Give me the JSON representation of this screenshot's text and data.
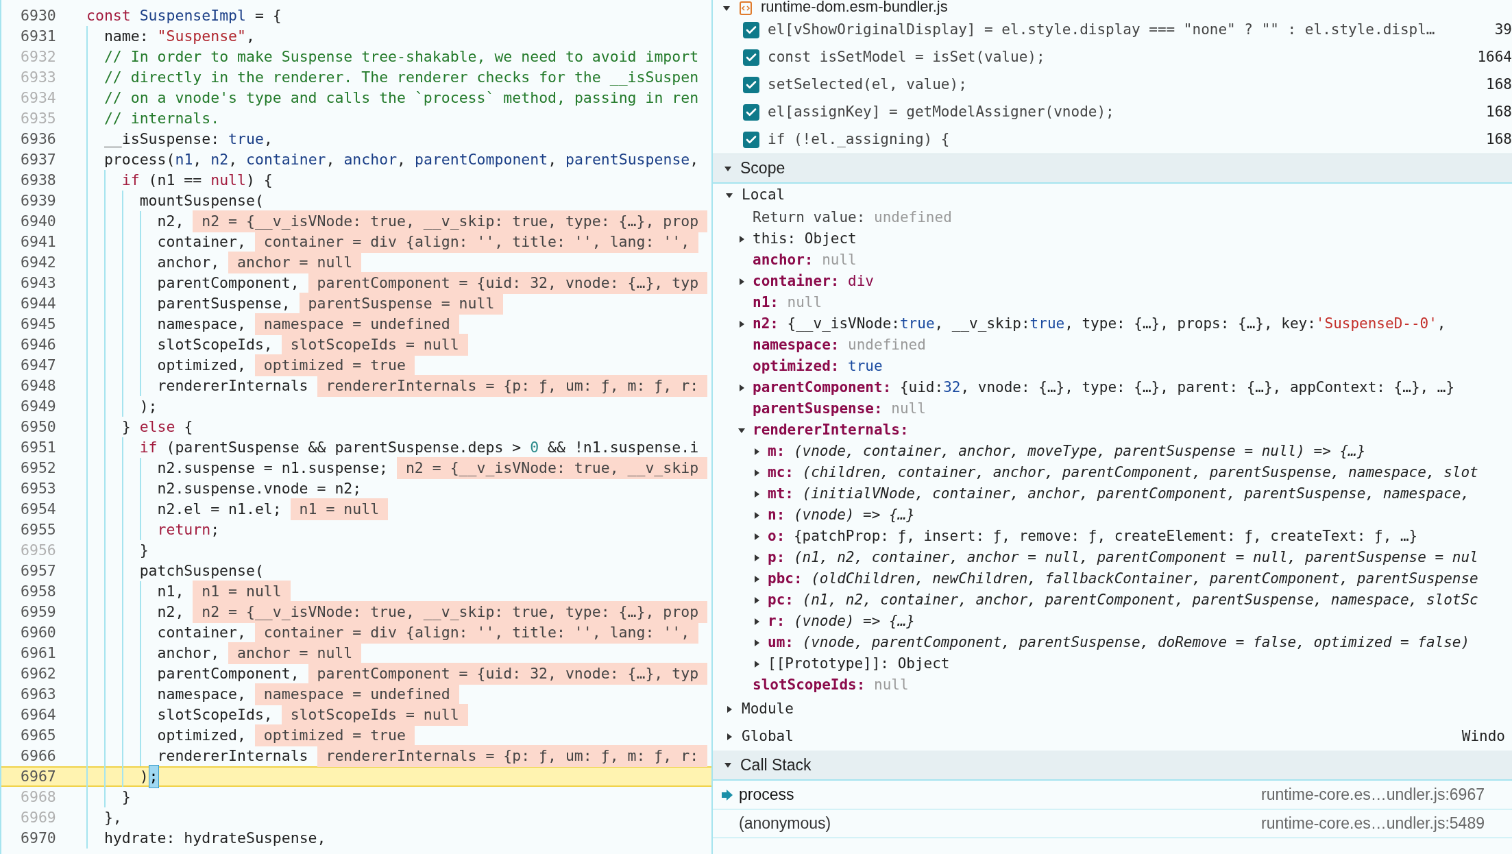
{
  "editor": {
    "lines": [
      {
        "number": "6930",
        "breakable": true,
        "code": [
          {
            "kind": "keyword",
            "text": "const"
          },
          {
            "kind": "name",
            "text": " SuspenseImpl"
          },
          {
            "kind": "plain",
            "text": " = {"
          }
        ],
        "children": [
          {
            "number": "6931",
            "breakable": true,
            "code": [
              {
                "kind": "plain",
                "text": "name:"
              },
              {
                "kind": "string",
                "text": " \"Suspense\""
              },
              {
                "kind": "plain",
                "text": ","
              }
            ]
          },
          {
            "number": "6932",
            "breakable": false,
            "code": [
              {
                "kind": "comment",
                "text": "// In order to make Suspense tree-shakable, we need to avoid import"
              }
            ]
          },
          {
            "number": "6933",
            "breakable": false,
            "code": [
              {
                "kind": "comment",
                "text": "// directly in the renderer. The renderer checks for the __isSuspen"
              }
            ]
          },
          {
            "number": "6934",
            "breakable": false,
            "code": [
              {
                "kind": "comment",
                "text": "// on a vnode's type and calls the `process` method, passing in ren"
              }
            ]
          },
          {
            "number": "6935",
            "breakable": false,
            "code": [
              {
                "kind": "comment",
                "text": "// internals."
              }
            ]
          },
          {
            "number": "6936",
            "breakable": true,
            "code": [
              {
                "kind": "plain",
                "text": "__isSuspense:"
              },
              {
                "kind": "literal",
                "text": " true"
              },
              {
                "kind": "plain",
                "text": ","
              }
            ]
          },
          {
            "number": "6937",
            "breakable": true,
            "code": [
              {
                "kind": "plain",
                "text": "process("
              },
              {
                "kind": "name",
                "text": "n1"
              },
              {
                "kind": "plain",
                "text": ","
              },
              {
                "kind": "name",
                "text": " n2"
              },
              {
                "kind": "plain",
                "text": ","
              },
              {
                "kind": "name",
                "text": " container"
              },
              {
                "kind": "plain",
                "text": ","
              },
              {
                "kind": "name",
                "text": " anchor"
              },
              {
                "kind": "plain",
                "text": ","
              },
              {
                "kind": "name",
                "text": " parentComponent"
              },
              {
                "kind": "plain",
                "text": ","
              },
              {
                "kind": "name",
                "text": " parentSuspense"
              },
              {
                "kind": "plain",
                "text": ","
              }
            ],
            "children": [
              {
                "number": "6938",
                "breakable": true,
                "code": [
                  {
                    "kind": "keyword",
                    "text": "if"
                  },
                  {
                    "kind": "plain",
                    "text": " (n1 =="
                  },
                  {
                    "kind": "keyword",
                    "text": " null"
                  },
                  {
                    "kind": "plain",
                    "text": ") {"
                  }
                ],
                "children": [
                  {
                    "number": "6939",
                    "breakable": true,
                    "code": [
                      {
                        "kind": "plain",
                        "text": "mountSuspense("
                      }
                    ],
                    "children": [
                      {
                        "number": "6940",
                        "breakable": true,
                        "code": [
                          {
                            "kind": "plain",
                            "text": "n2,"
                          }
                        ],
                        "value": "n2 = {__v_isVNode: true, __v_skip: true, type: {…}, prop"
                      },
                      {
                        "number": "6941",
                        "breakable": true,
                        "code": [
                          {
                            "kind": "plain",
                            "text": "container,"
                          }
                        ],
                        "value": "container = div {align: '', title: '', lang: '',"
                      },
                      {
                        "number": "6942",
                        "breakable": true,
                        "code": [
                          {
                            "kind": "plain",
                            "text": "anchor,"
                          }
                        ],
                        "value": "anchor = null"
                      },
                      {
                        "number": "6943",
                        "breakable": true,
                        "code": [
                          {
                            "kind": "plain",
                            "text": "parentComponent,"
                          }
                        ],
                        "value": "parentComponent = {uid: 32, vnode: {…}, typ"
                      },
                      {
                        "number": "6944",
                        "breakable": true,
                        "code": [
                          {
                            "kind": "plain",
                            "text": "parentSuspense,"
                          }
                        ],
                        "value": "parentSuspense = null"
                      },
                      {
                        "number": "6945",
                        "breakable": true,
                        "code": [
                          {
                            "kind": "plain",
                            "text": "namespace,"
                          }
                        ],
                        "value": "namespace = undefined"
                      },
                      {
                        "number": "6946",
                        "breakable": true,
                        "code": [
                          {
                            "kind": "plain",
                            "text": "slotScopeIds,"
                          }
                        ],
                        "value": "slotScopeIds = null"
                      },
                      {
                        "number": "6947",
                        "breakable": true,
                        "code": [
                          {
                            "kind": "plain",
                            "text": "optimized,"
                          }
                        ],
                        "value": "optimized = true"
                      },
                      {
                        "number": "6948",
                        "breakable": true,
                        "code": [
                          {
                            "kind": "plain",
                            "text": "rendererInternals"
                          }
                        ],
                        "value": "rendererInternals = {p: ƒ, um: ƒ, m: ƒ, r:"
                      }
                    ]
                  },
                  {
                    "number": "6949",
                    "breakable": true,
                    "code": [
                      {
                        "kind": "plain",
                        "text": ");"
                      }
                    ]
                  }
                ]
              },
              {
                "number": "6950",
                "breakable": true,
                "code": [
                  {
                    "kind": "plain",
                    "text": "}"
                  },
                  {
                    "kind": "keyword",
                    "text": " else"
                  },
                  {
                    "kind": "plain",
                    "text": " {"
                  }
                ],
                "children": [
                  {
                    "number": "6951",
                    "breakable": true,
                    "code": [
                      {
                        "kind": "keyword",
                        "text": "if"
                      },
                      {
                        "kind": "plain",
                        "text": " (parentSuspense && parentSuspense.deps >"
                      },
                      {
                        "kind": "number",
                        "text": " 0"
                      },
                      {
                        "kind": "plain",
                        "text": " && !n1.suspense.i"
                      }
                    ],
                    "children": [
                      {
                        "number": "6952",
                        "breakable": true,
                        "code": [
                          {
                            "kind": "plain",
                            "text": "n2.suspense = n1.suspense;"
                          }
                        ],
                        "value": "n2 = {__v_isVNode: true, __v_skip"
                      },
                      {
                        "number": "6953",
                        "breakable": true,
                        "code": [
                          {
                            "kind": "plain",
                            "text": "n2.suspense.vnode = n2;"
                          }
                        ]
                      },
                      {
                        "number": "6954",
                        "breakable": true,
                        "code": [
                          {
                            "kind": "plain",
                            "text": "n2.el = n1.el;"
                          }
                        ],
                        "value": "n1 = null"
                      },
                      {
                        "number": "6955",
                        "breakable": true,
                        "code": [
                          {
                            "kind": "keyword",
                            "text": "return"
                          },
                          {
                            "kind": "plain",
                            "text": ";"
                          }
                        ]
                      }
                    ]
                  },
                  {
                    "number": "6956",
                    "breakable": false,
                    "code": [
                      {
                        "kind": "plain",
                        "text": "}"
                      }
                    ]
                  },
                  {
                    "number": "6957",
                    "breakable": true,
                    "code": [
                      {
                        "kind": "plain",
                        "text": "patchSuspense("
                      }
                    ],
                    "children": [
                      {
                        "number": "6958",
                        "breakable": true,
                        "code": [
                          {
                            "kind": "plain",
                            "text": "n1,"
                          }
                        ],
                        "value": "n1 = null"
                      },
                      {
                        "number": "6959",
                        "breakable": true,
                        "code": [
                          {
                            "kind": "plain",
                            "text": "n2,"
                          }
                        ],
                        "value": "n2 = {__v_isVNode: true, __v_skip: true, type: {…}, prop"
                      },
                      {
                        "number": "6960",
                        "breakable": true,
                        "code": [
                          {
                            "kind": "plain",
                            "text": "container,"
                          }
                        ],
                        "value": "container = div {align: '', title: '', lang: '',"
                      },
                      {
                        "number": "6961",
                        "breakable": true,
                        "code": [
                          {
                            "kind": "plain",
                            "text": "anchor,"
                          }
                        ],
                        "value": "anchor = null"
                      },
                      {
                        "number": "6962",
                        "breakable": true,
                        "code": [
                          {
                            "kind": "plain",
                            "text": "parentComponent,"
                          }
                        ],
                        "value": "parentComponent = {uid: 32, vnode: {…}, typ"
                      },
                      {
                        "number": "6963",
                        "breakable": true,
                        "code": [
                          {
                            "kind": "plain",
                            "text": "namespace,"
                          }
                        ],
                        "value": "namespace = undefined"
                      },
                      {
                        "number": "6964",
                        "breakable": true,
                        "code": [
                          {
                            "kind": "plain",
                            "text": "slotScopeIds,"
                          }
                        ],
                        "value": "slotScopeIds = null"
                      },
                      {
                        "number": "6965",
                        "breakable": true,
                        "code": [
                          {
                            "kind": "plain",
                            "text": "optimized,"
                          }
                        ],
                        "value": "optimized = true"
                      },
                      {
                        "number": "6966",
                        "breakable": true,
                        "code": [
                          {
                            "kind": "plain",
                            "text": "rendererInternals"
                          }
                        ],
                        "value": "rendererInternals = {p: ƒ, um: ƒ, m: ƒ, r:"
                      }
                    ]
                  },
                  {
                    "number": "6967",
                    "breakable": true,
                    "current": true,
                    "code": [
                      {
                        "kind": "plain",
                        "text": ")"
                      }
                    ],
                    "pause": ";"
                  }
                ]
              },
              {
                "number": "6968",
                "breakable": false,
                "code": [
                  {
                    "kind": "plain",
                    "text": "}"
                  }
                ]
              }
            ]
          },
          {
            "number": "6969",
            "breakable": false,
            "code": [
              {
                "kind": "plain",
                "text": "},"
              }
            ]
          },
          {
            "number": "6970",
            "breakable": true,
            "code": [
              {
                "kind": "plain",
                "text": "hydrate: hydrateSuspense,"
              }
            ]
          }
        ]
      }
    ]
  },
  "breakpoints": {
    "file": "runtime-dom.esm-bundler.js",
    "expanded": true,
    "items": [
      {
        "code": "el[vShowOriginalDisplay] = el.style.display === \"none\" ? \"\" : el.style.displ…",
        "line": "39",
        "checked": true
      },
      {
        "code": "const isSetModel = isSet(value);",
        "line": "1664",
        "checked": true
      },
      {
        "code": "setSelected(el, value);",
        "line": "168",
        "checked": true
      },
      {
        "code": "el[assignKey] = getModelAssigner(vnode);",
        "line": "168",
        "checked": true
      },
      {
        "code": "if (!el._assigning) {",
        "line": "168",
        "checked": true
      }
    ]
  },
  "scope": {
    "title": "Scope",
    "expanded": true,
    "groups": [
      {
        "name": "Local",
        "expanded": true,
        "children": [
          {
            "key": "Return value:",
            "kind": "dim",
            "expandable": false,
            "value": [
              {
                "kind": "null",
                "text": "undefined"
              }
            ]
          },
          {
            "key": "this:",
            "kind": "plain",
            "expandable": true,
            "expanded": false,
            "value": [
              {
                "kind": "plain",
                "text": "Object"
              }
            ]
          },
          {
            "key": "anchor:",
            "kind": "own",
            "expandable": false,
            "value": [
              {
                "kind": "null",
                "text": "null"
              }
            ]
          },
          {
            "key": "container:",
            "kind": "own",
            "expandable": true,
            "expanded": false,
            "value": [
              {
                "kind": "keyword",
                "text": "div"
              }
            ]
          },
          {
            "key": "n1:",
            "kind": "own",
            "expandable": false,
            "value": [
              {
                "kind": "null",
                "text": "null"
              }
            ]
          },
          {
            "key": "n2:",
            "kind": "own",
            "expandable": true,
            "expanded": false,
            "value": [
              {
                "kind": "plain",
                "text": "{__v_isVNode:"
              },
              {
                "kind": "literal",
                "text": "true"
              },
              {
                "kind": "plain",
                "text": ", __v_skip:"
              },
              {
                "kind": "literal",
                "text": "true"
              },
              {
                "kind": "plain",
                "text": ", type: {…}, props: {…}, key:"
              },
              {
                "kind": "string",
                "text": "'SuspenseD--0'"
              },
              {
                "kind": "plain",
                "text": ","
              }
            ]
          },
          {
            "key": "namespace:",
            "kind": "own",
            "expandable": false,
            "value": [
              {
                "kind": "null",
                "text": "undefined"
              }
            ]
          },
          {
            "key": "optimized:",
            "kind": "own",
            "expandable": false,
            "value": [
              {
                "kind": "literal",
                "text": "true"
              }
            ]
          },
          {
            "key": "parentComponent:",
            "kind": "own",
            "expandable": true,
            "expanded": false,
            "value": [
              {
                "kind": "plain",
                "text": "{uid:"
              },
              {
                "kind": "literal",
                "text": "32"
              },
              {
                "kind": "plain",
                "text": ", vnode: {…}, type: {…}, parent: {…}, appContext: {…}, …}"
              }
            ]
          },
          {
            "key": "parentSuspense:",
            "kind": "own",
            "expandable": false,
            "value": [
              {
                "kind": "null",
                "text": "null"
              }
            ]
          },
          {
            "key": "rendererInternals:",
            "kind": "own",
            "expandable": true,
            "expanded": true,
            "children": [
              {
                "key": "m:",
                "kind": "own",
                "expandable": true,
                "expanded": false,
                "value": [
                  {
                    "kind": "function",
                    "text": "(vnode, container, anchor, moveType, parentSuspense = null) => {…}"
                  }
                ]
              },
              {
                "key": "mc:",
                "kind": "own",
                "expandable": true,
                "expanded": false,
                "value": [
                  {
                    "kind": "function",
                    "text": "(children, container, anchor, parentComponent, parentSuspense, namespace, slot"
                  }
                ]
              },
              {
                "key": "mt:",
                "kind": "own",
                "expandable": true,
                "expanded": false,
                "value": [
                  {
                    "kind": "function",
                    "text": "(initialVNode, container, anchor, parentComponent, parentSuspense, namespace,"
                  }
                ]
              },
              {
                "key": "n:",
                "kind": "own",
                "expandable": true,
                "expanded": false,
                "value": [
                  {
                    "kind": "function",
                    "text": "(vnode) => {…}"
                  }
                ]
              },
              {
                "key": "o:",
                "kind": "own",
                "expandable": true,
                "expanded": false,
                "value": [
                  {
                    "kind": "plain",
                    "text": "{patchProp: ƒ, insert: ƒ, remove: ƒ, createElement: ƒ, createText: ƒ, …}"
                  }
                ]
              },
              {
                "key": "p:",
                "kind": "own",
                "expandable": true,
                "expanded": false,
                "value": [
                  {
                    "kind": "function",
                    "text": "(n1, n2, container, anchor = null, parentComponent = null, parentSuspense = nul"
                  }
                ]
              },
              {
                "key": "pbc:",
                "kind": "own",
                "expandable": true,
                "expanded": false,
                "value": [
                  {
                    "kind": "function",
                    "text": "(oldChildren, newChildren, fallbackContainer, parentComponent, parentSuspense"
                  }
                ]
              },
              {
                "key": "pc:",
                "kind": "own",
                "expandable": true,
                "expanded": false,
                "value": [
                  {
                    "kind": "function",
                    "text": "(n1, n2, container, anchor, parentComponent, parentSuspense, namespace, slotSc"
                  }
                ]
              },
              {
                "key": "r:",
                "kind": "own",
                "expandable": true,
                "expanded": false,
                "value": [
                  {
                    "kind": "function",
                    "text": "(vnode) => {…}"
                  }
                ]
              },
              {
                "key": "um:",
                "kind": "own",
                "expandable": true,
                "expanded": false,
                "value": [
                  {
                    "kind": "function",
                    "text": "(vnode, parentComponent, parentSuspense, doRemove = false, optimized = false)"
                  }
                ]
              },
              {
                "key": "[[Prototype]]:",
                "kind": "plain",
                "expandable": true,
                "expanded": false,
                "value": [
                  {
                    "kind": "plain",
                    "text": "Object"
                  }
                ]
              }
            ]
          },
          {
            "key": "slotScopeIds:",
            "kind": "own",
            "expandable": false,
            "value": [
              {
                "kind": "null",
                "text": "null"
              }
            ]
          }
        ]
      },
      {
        "name": "Module",
        "expanded": false
      },
      {
        "name": "Global",
        "expanded": false,
        "value": "Windo"
      }
    ]
  },
  "call_stack": {
    "title": "Call Stack",
    "expanded": true,
    "frames": [
      {
        "name": "process",
        "location": "runtime-core.es…undler.js:6967",
        "selected": true
      },
      {
        "name": "(anonymous)",
        "location": "runtime-core.es…undler.js:5489",
        "selected": false
      }
    ]
  }
}
